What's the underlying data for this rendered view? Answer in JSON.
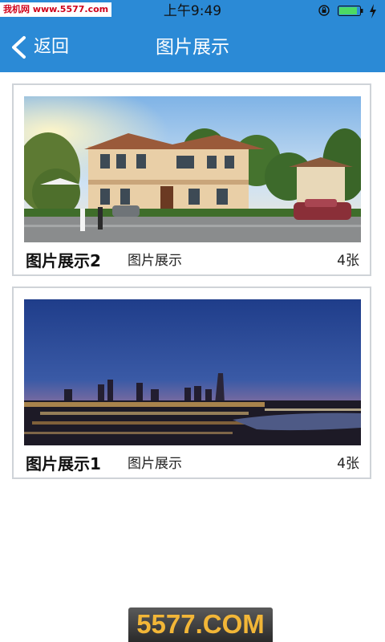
{
  "status_bar": {
    "carrier": "我机网 www.5577.com",
    "time": "上午9:49"
  },
  "nav": {
    "back_label": "返回",
    "title": "图片展示"
  },
  "gallery": [
    {
      "title": "图片展示2",
      "subtitle": "图片展示",
      "count": "4张",
      "image": "villa-photo"
    },
    {
      "title": "图片展示1",
      "subtitle": "图片展示",
      "count": "4张",
      "image": "city-night-photo"
    }
  ],
  "watermark": "5577.COM",
  "colors": {
    "primary": "#2b8ad6",
    "card_border": "#cfd3d8",
    "watermark_text": "#f2b637"
  }
}
